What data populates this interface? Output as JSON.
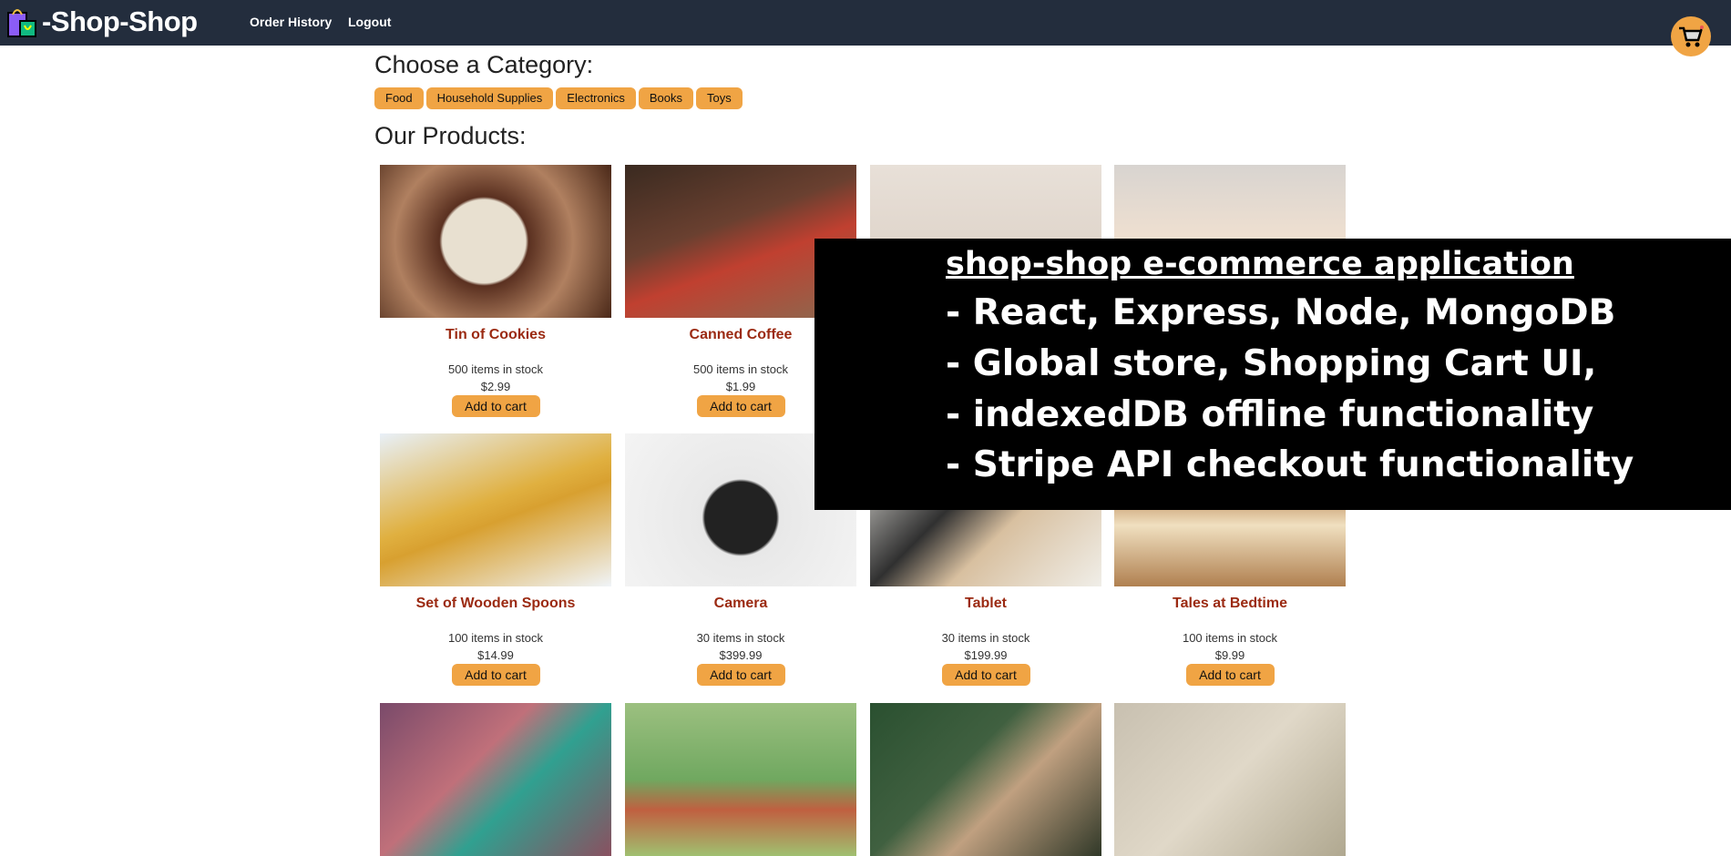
{
  "header": {
    "brand": "-Shop-Shop",
    "nav": [
      "Order History",
      "Logout"
    ]
  },
  "categories": {
    "heading": "Choose a Category:",
    "items": [
      "Food",
      "Household Supplies",
      "Electronics",
      "Books",
      "Toys"
    ]
  },
  "products": {
    "heading": "Our Products:",
    "add_label": "Add to cart",
    "items": [
      {
        "name": "Tin of Cookies",
        "stock": "500 items in stock",
        "price": "$2.99"
      },
      {
        "name": "Canned Coffee",
        "stock": "500 items in stock",
        "price": "$1.99"
      },
      {
        "name": "",
        "stock": "",
        "price": ""
      },
      {
        "name": "",
        "stock": "",
        "price": ""
      },
      {
        "name": "Set of Wooden Spoons",
        "stock": "100 items in stock",
        "price": "$14.99"
      },
      {
        "name": "Camera",
        "stock": "30 items in stock",
        "price": "$399.99"
      },
      {
        "name": "Tablet",
        "stock": "30 items in stock",
        "price": "$199.99"
      },
      {
        "name": "Tales at Bedtime",
        "stock": "100 items in stock",
        "price": "$9.99"
      }
    ]
  },
  "overlay": {
    "title": "shop-shop e-commerce application",
    "lines": [
      "-  React, Express, Node, MongoDB",
      "-  Global store, Shopping Cart UI,",
      "-  indexedDB offline functionality",
      "-  Stripe API checkout functionality"
    ]
  },
  "colors": {
    "header": "#232d3d",
    "accent": "#f0a444",
    "product_name": "#9b2a12"
  },
  "icons": {
    "logo": "shopping-bag-icon",
    "cart": "shopping-cart-icon"
  }
}
